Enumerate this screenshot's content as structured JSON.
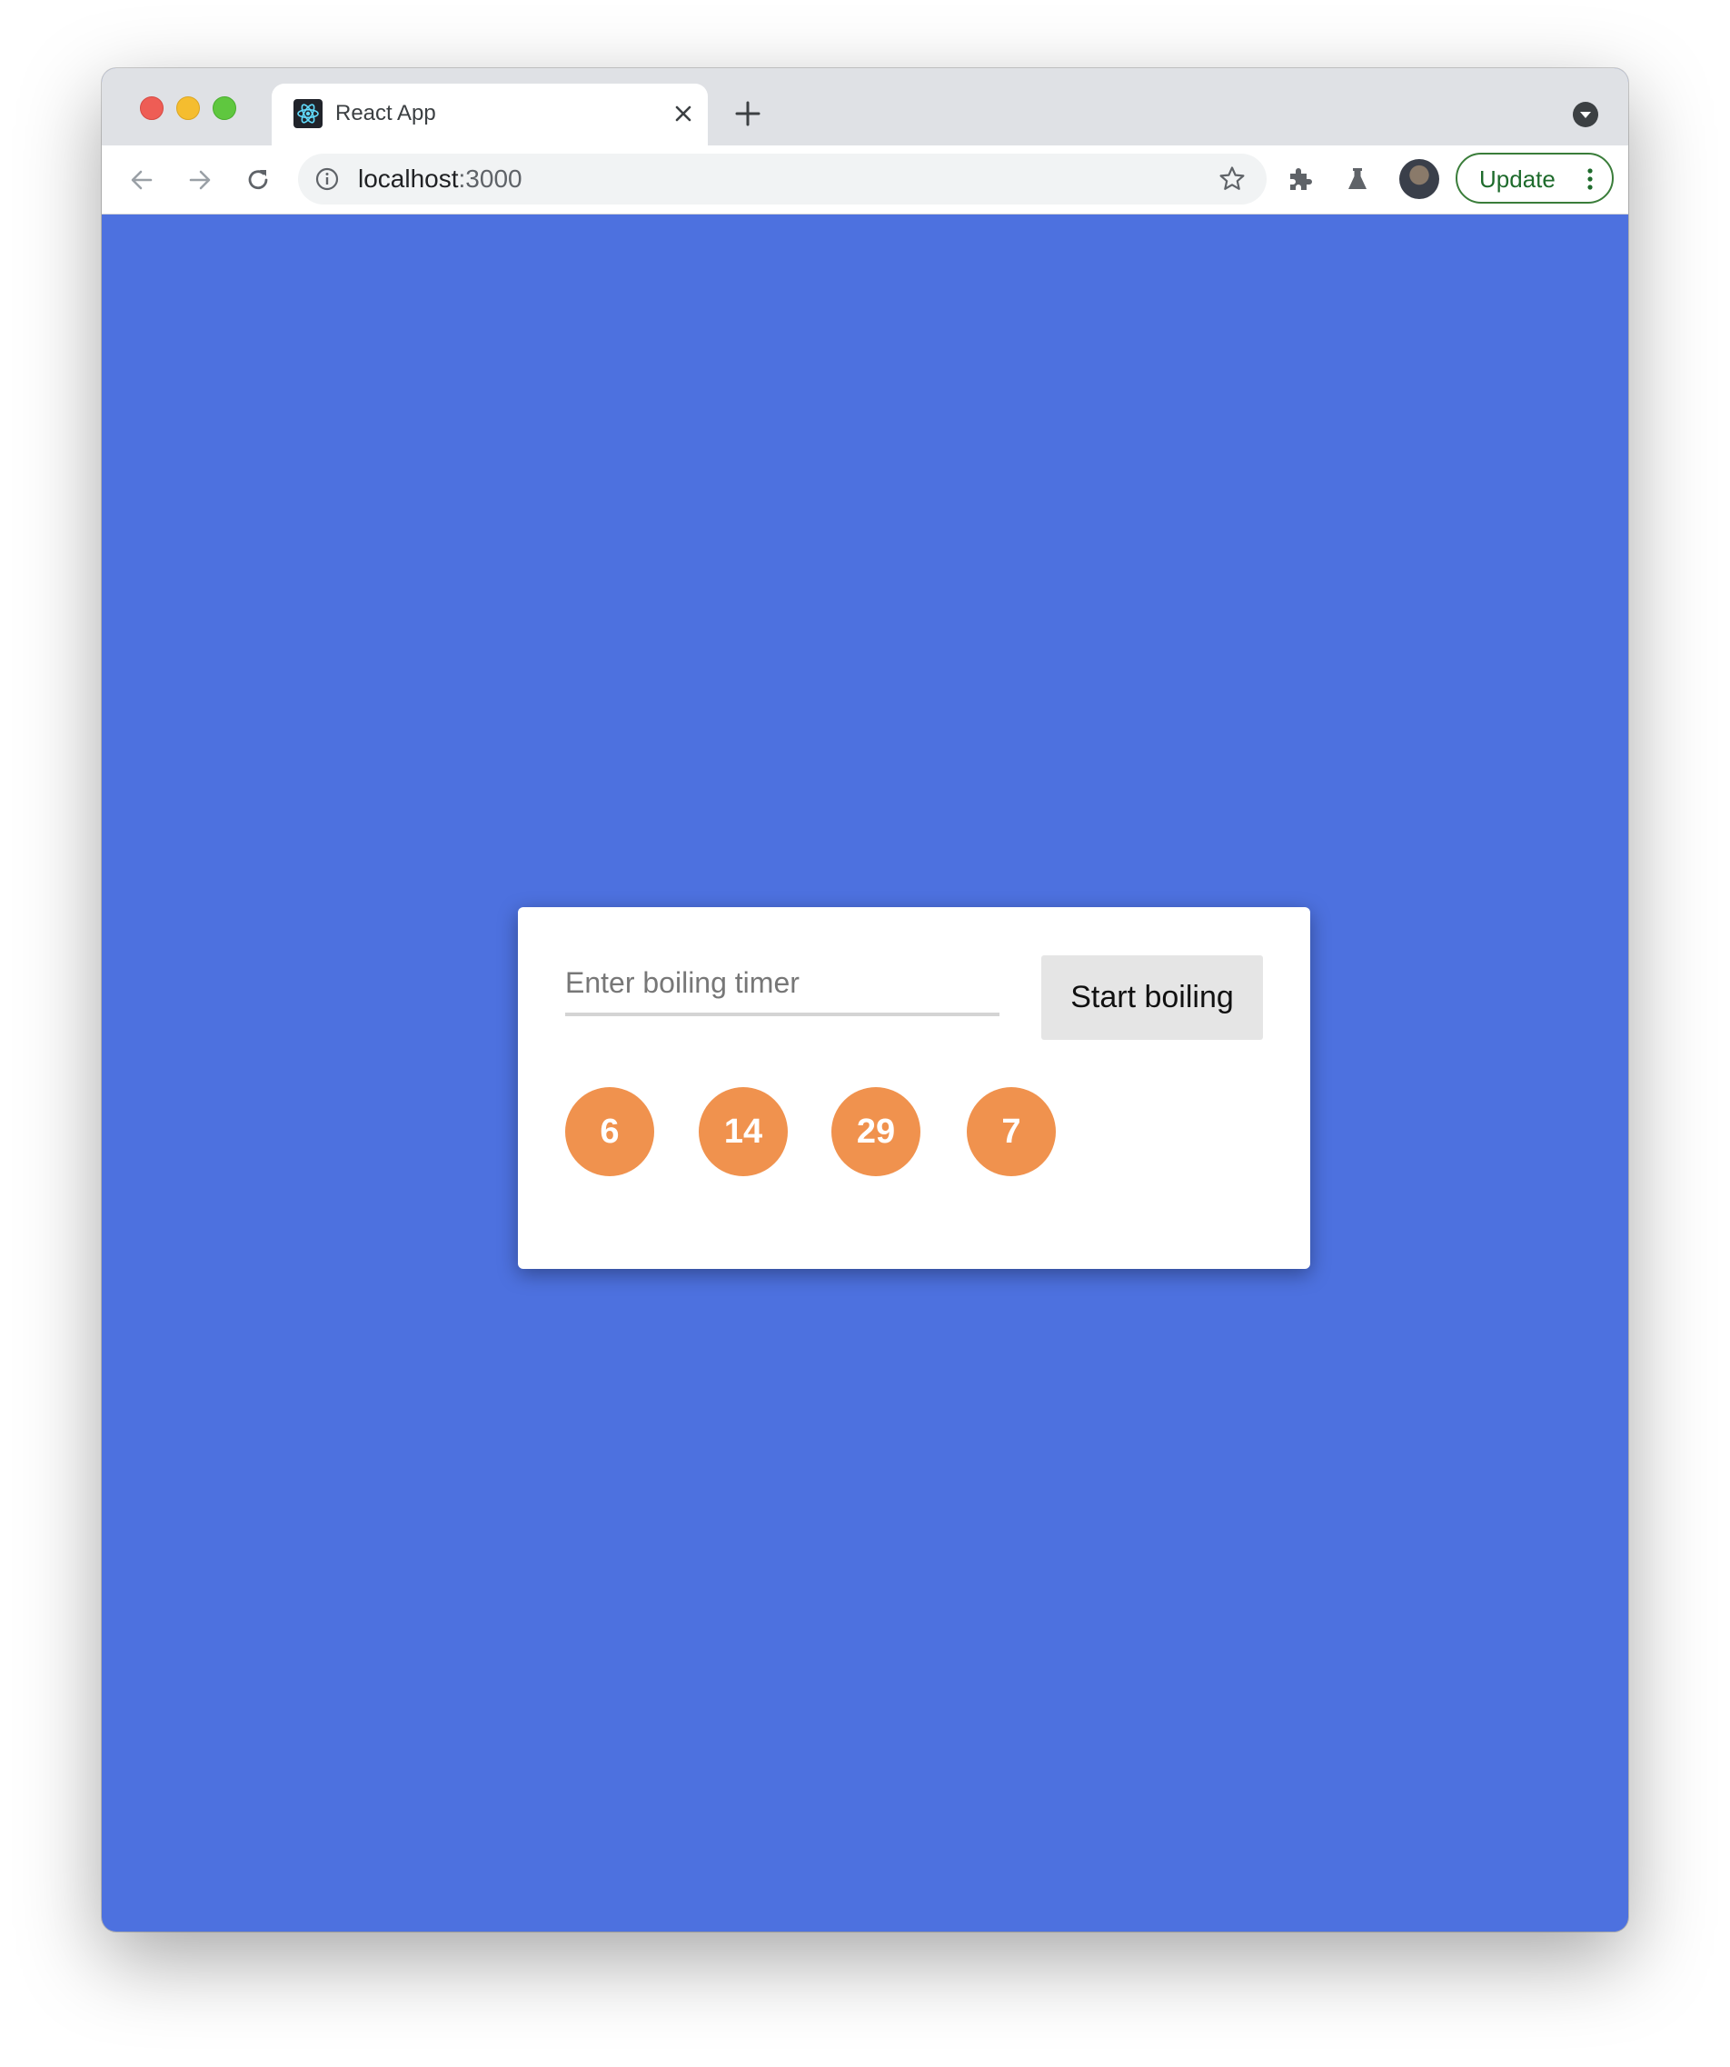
{
  "browser": {
    "tab": {
      "title": "React App"
    },
    "address": {
      "host": "localhost",
      "port": ":3000"
    },
    "update_label": "Update"
  },
  "icons": {
    "tab_favicon": "react-logo-icon",
    "tab_close": "close-icon",
    "new_tab": "plus-icon",
    "tab_search": "chevron-down-icon",
    "back": "arrow-left-icon",
    "forward": "arrow-right-icon",
    "reload": "reload-icon",
    "site_info": "info-icon",
    "bookmark": "star-icon",
    "extensions": "puzzle-icon",
    "labs": "flask-icon",
    "profile": "avatar",
    "menu": "kebab-menu-icon"
  },
  "app": {
    "input_placeholder": "Enter boiling timer",
    "input_value": "",
    "start_button": "Start boiling",
    "timers": [
      "6",
      "14",
      "29",
      "7"
    ]
  },
  "colors": {
    "page_background": "#4d71df",
    "timer_bubble": "#f0924e",
    "button_background": "#e5e5e5",
    "update_green": "#1e6b2c"
  }
}
